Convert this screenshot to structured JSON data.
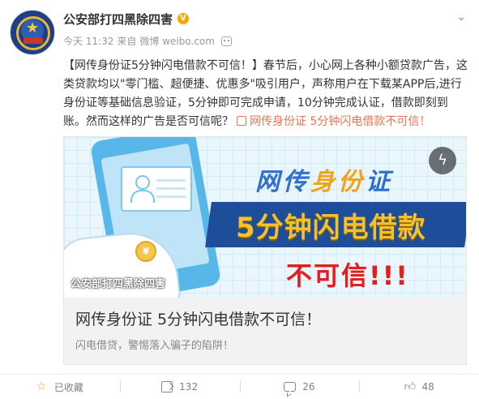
{
  "post": {
    "author": "公安部打四黑除四害",
    "verified_mark": "V",
    "time": "今天 11:32",
    "source_prefix": "来自",
    "source": "微博 weibo.com",
    "text_main": "【网传身份证5分钟闪电借款不可信！】春节后，小心网上各种小额贷款广告，这类贷款均以\"零门槛、超便捷、优惠多\"吸引用户，声称用户在下载某APP后,进行身份证等基础信息验证，5分钟即可完成申请，10分钟完成认证，借款即刻到账。然而这样的广告是否可信呢？",
    "text_link": "网传身份证 5分钟闪电借款不可信！"
  },
  "article": {
    "cover_line1_a": "网传",
    "cover_line1_b": "身份",
    "cover_line1_c": "证",
    "cover_line2": "5分钟闪电借款",
    "cover_line3": "不可信!!!",
    "coin": "¥",
    "watermark": "公安部打四黑除四害",
    "title": "网传身份证 5分钟闪电借款不可信！",
    "description": "闪电借贷，警惕落入骗子的陷阱！"
  },
  "footer": {
    "favorite_label": "已收藏",
    "share_count": "132",
    "comment_count": "26",
    "like_count": "48"
  },
  "colors": {
    "link": "#eb7350",
    "favorite": "#f1a520",
    "verified": "#f6a800"
  },
  "icons": [
    "chevron-down-icon",
    "robot-icon",
    "link-icon",
    "flash-icon",
    "star-icon",
    "share-icon",
    "comment-icon",
    "like-icon"
  ]
}
